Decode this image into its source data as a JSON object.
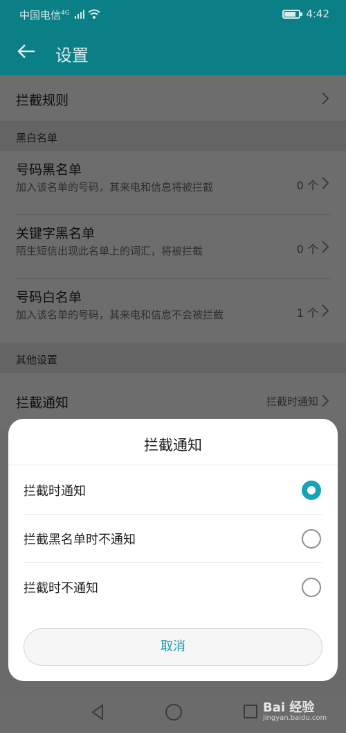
{
  "status": {
    "carrier": "中国电信",
    "net": "4G",
    "time": "4:42"
  },
  "header": {
    "title": "设置"
  },
  "list": {
    "rules": {
      "label": "拦截规则"
    },
    "section1": "黑白名单",
    "blacklist": {
      "label": "号码黑名单",
      "desc": "加入该名单的号码，其来电和信息将被拦截",
      "count": "0 个"
    },
    "keyword": {
      "label": "关键字黑名单",
      "desc": "陌生短信出现此名单上的词汇，将被拦截",
      "count": "0 个"
    },
    "whitelist": {
      "label": "号码白名单",
      "desc": "加入该名单的号码，其来电和信息不会被拦截",
      "count": "1 个"
    },
    "section2": "其他设置",
    "notify": {
      "label": "拦截通知",
      "value": "拦截时通知"
    }
  },
  "dialog": {
    "title": "拦截通知",
    "options": [
      {
        "label": "拦截时通知",
        "selected": true
      },
      {
        "label": "拦截黑名单时不通知",
        "selected": false
      },
      {
        "label": "拦截时不通知",
        "selected": false
      }
    ],
    "cancel": "取消"
  },
  "watermark": {
    "brand": "Bai 经验",
    "url": "jingyan.baidu.com"
  },
  "colors": {
    "accent": "#17a3b4",
    "header": "#0b7f86"
  }
}
